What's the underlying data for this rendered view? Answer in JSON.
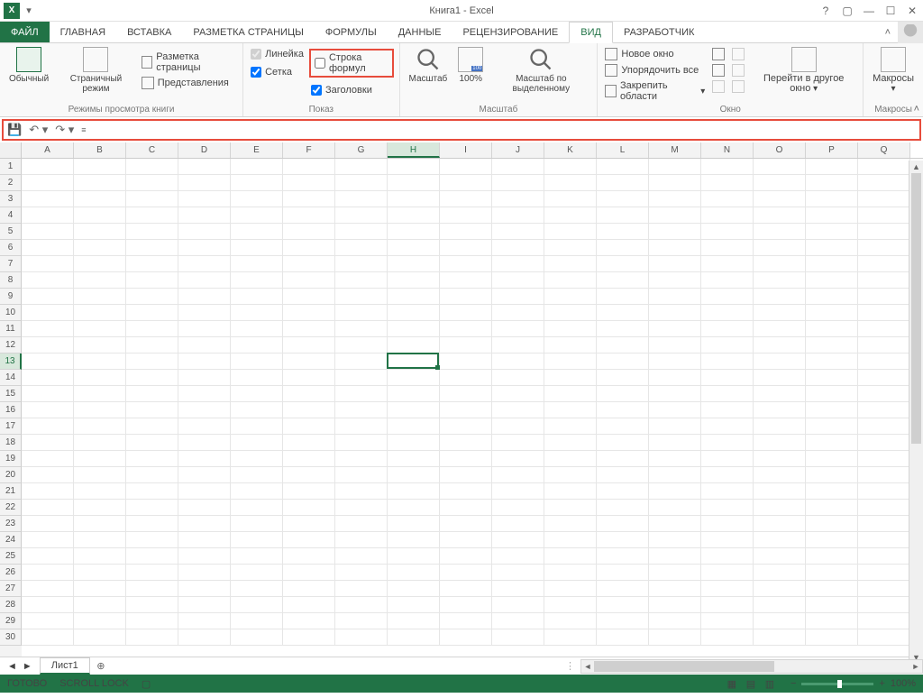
{
  "title": "Книга1 - Excel",
  "tabs": [
    "ФАЙЛ",
    "ГЛАВНАЯ",
    "ВСТАВКА",
    "РАЗМЕТКА СТРАНИЦЫ",
    "ФОРМУЛЫ",
    "ДАННЫЕ",
    "РЕЦЕНЗИРОВАНИЕ",
    "ВИД",
    "РАЗРАБОТЧИК"
  ],
  "active_tab": "ВИД",
  "ribbon": {
    "views": {
      "normal": "Обычный",
      "page": "Страничный режим",
      "layout": "Разметка страницы",
      "custom": "Представления",
      "group": "Режимы просмотра книги"
    },
    "show": {
      "ruler": "Линейка",
      "formula_bar": "Строка формул",
      "gridlines": "Сетка",
      "headings": "Заголовки",
      "group": "Показ"
    },
    "zoom": {
      "zoom": "Масштаб",
      "pct": "100%",
      "to_sel": "Масштаб по выделенному",
      "group": "Масштаб"
    },
    "window": {
      "new": "Новое окно",
      "arrange": "Упорядочить все",
      "freeze": "Закрепить области",
      "switch": "Перейти в другое окно",
      "group": "Окно"
    },
    "macros": {
      "macros": "Макросы",
      "group": "Макросы"
    }
  },
  "columns": [
    "A",
    "B",
    "C",
    "D",
    "E",
    "F",
    "G",
    "H",
    "I",
    "J",
    "K",
    "L",
    "M",
    "N",
    "O",
    "P",
    "Q"
  ],
  "rows_count": 30,
  "selected_col": "H",
  "selected_row": 13,
  "sheet": {
    "name": "Лист1"
  },
  "status": {
    "ready": "ГОТОВО",
    "scroll": "SCROLL LOCK",
    "zoom": "100%"
  }
}
